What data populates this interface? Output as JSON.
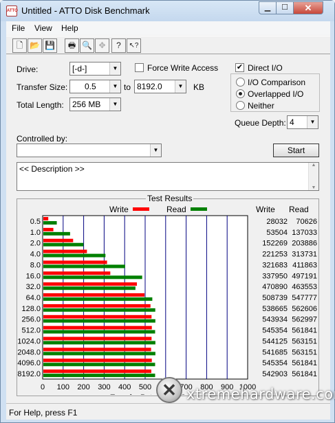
{
  "window": {
    "title": "Untitled - ATTO Disk Benchmark",
    "app_icon_text": "ATTO",
    "min_glyph": "▁",
    "max_glyph": "☐",
    "close_glyph": "✕"
  },
  "menu": {
    "items": [
      "File",
      "View",
      "Help"
    ]
  },
  "toolbar": {
    "buttons": [
      {
        "name": "new-icon",
        "glyph": "🗋"
      },
      {
        "name": "open-icon",
        "glyph": "📂"
      },
      {
        "name": "save-icon",
        "glyph": "💾"
      },
      {
        "name": "print-icon",
        "glyph": "🖶"
      },
      {
        "name": "print-preview-icon",
        "glyph": "🔍"
      },
      {
        "name": "move-icon",
        "glyph": "✥"
      },
      {
        "name": "help-icon",
        "glyph": "?"
      },
      {
        "name": "context-help-icon",
        "glyph": "↖?"
      }
    ]
  },
  "settings": {
    "drive_label": "Drive:",
    "drive_value": "[-d-]",
    "force_write_label": "Force Write Access",
    "force_write_checked": false,
    "transfer_size_label": "Transfer Size:",
    "transfer_from": "0.5",
    "to_label": "to",
    "transfer_to": "8192.0",
    "kb_label": "KB",
    "total_length_label": "Total Length:",
    "total_length_value": "256 MB",
    "direct_io_label": "Direct I/O",
    "direct_io_checked": true,
    "io_comparison_label": "I/O Comparison",
    "overlapped_io_label": "Overlapped I/O",
    "neither_label": "Neither",
    "selected_mode": "Overlapped I/O",
    "queue_depth_label": "Queue Depth:",
    "queue_depth_value": "4",
    "controlled_by_label": "Controlled by:",
    "controlled_by_value": "",
    "start_label": "Start",
    "description_text": "<< Description >>"
  },
  "results": {
    "title": "Test Results",
    "write_legend": "Write",
    "read_legend": "Read",
    "write_col": "Write",
    "read_col": "Read",
    "write_color": "#ff0000",
    "read_color": "#008000"
  },
  "chart_data": {
    "type": "bar",
    "orientation": "horizontal",
    "title": "Test Results",
    "xlabel": "Transfer Rate - MB / Sec",
    "xlim": [
      0,
      1000
    ],
    "xticks": [
      "0",
      "100",
      "200",
      "300",
      "400",
      "500",
      "600",
      "700",
      "800",
      "900",
      "1000"
    ],
    "categories": [
      "0.5",
      "1.0",
      "2.0",
      "4.0",
      "8.0",
      "16.0",
      "32.0",
      "64.0",
      "128.0",
      "256.0",
      "512.0",
      "1024.0",
      "2048.0",
      "4096.0",
      "8192.0"
    ],
    "series": [
      {
        "name": "Write",
        "color": "#ff0000",
        "values": [
          28032,
          53504,
          152269,
          221253,
          321683,
          337950,
          470890,
          508739,
          538665,
          543934,
          545354,
          544125,
          541685,
          545354,
          542903
        ]
      },
      {
        "name": "Read",
        "color": "#008000",
        "values": [
          70626,
          137033,
          203886,
          313731,
          411863,
          497191,
          463553,
          547777,
          562606,
          562997,
          561841,
          563151,
          563151,
          561841,
          561841
        ]
      }
    ],
    "write_text": [
      "28032",
      "53504",
      "152269",
      "221253",
      "321683",
      "337950",
      "470890",
      "508739",
      "538665",
      "543934",
      "545354",
      "544125",
      "541685",
      "545354",
      "542903"
    ],
    "read_text": [
      "70626",
      "137033",
      "203886",
      "313731",
      "411863",
      "497191",
      "463553",
      "547777",
      "562606",
      "562997",
      "561841",
      "563151",
      "563151",
      "561841",
      "561841"
    ],
    "grid": true,
    "legend": "top"
  },
  "status": {
    "text": "For Help, press F1"
  },
  "watermark": {
    "text": "xtremehardware.com",
    "logo_glyph": "✕"
  }
}
